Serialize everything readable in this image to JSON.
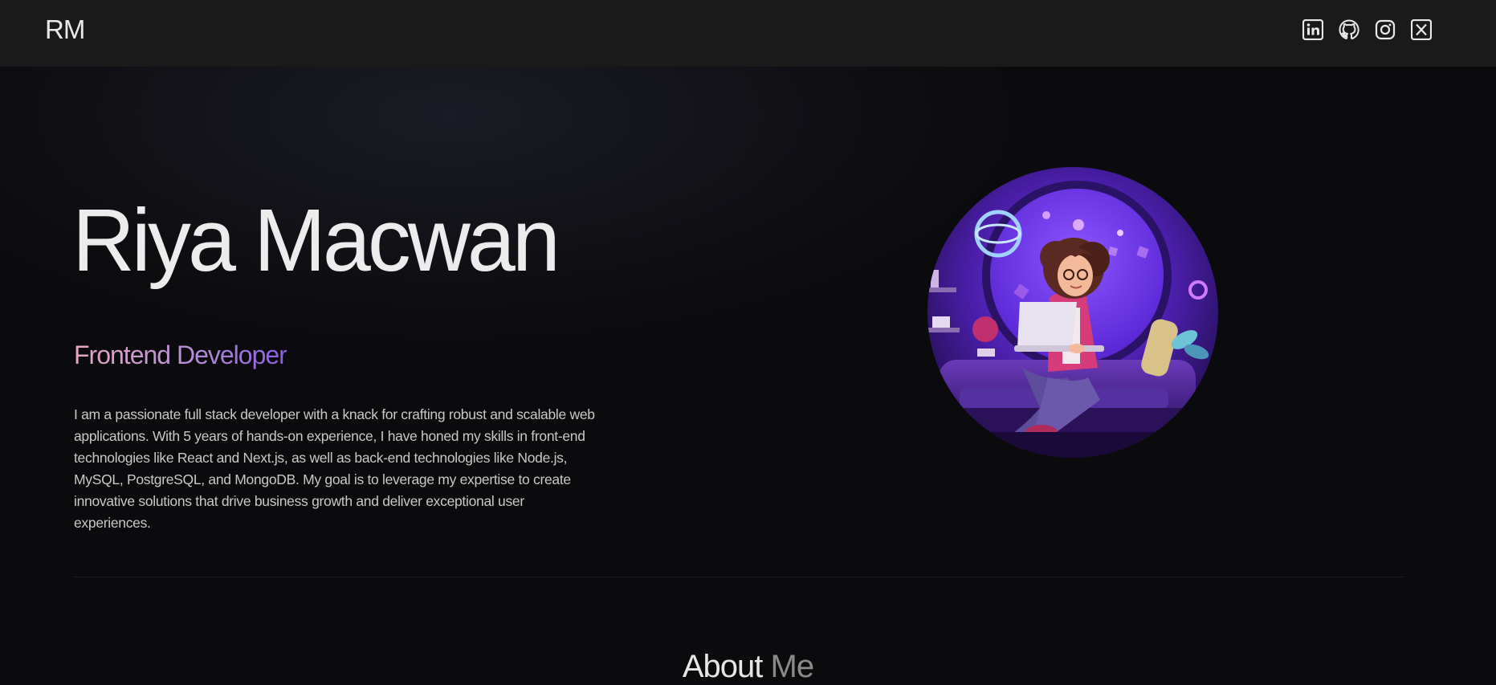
{
  "brand": {
    "logo_text": "RM"
  },
  "socials": [
    {
      "name": "linkedin",
      "icon": "linkedin-icon"
    },
    {
      "name": "github",
      "icon": "github-icon"
    },
    {
      "name": "instagram",
      "icon": "instagram-icon"
    },
    {
      "name": "x",
      "icon": "x-icon"
    }
  ],
  "hero": {
    "name": "Riya Macwan",
    "role": "Frontend Developer",
    "bio": "I am a passionate full stack developer with a knack for crafting robust and scalable web applications. With 5 years of hands-on experience, I have honed my skills in front-end technologies like React and Next.js, as well as back-end technologies like Node.js, MySQL, PostgreSQL, and MongoDB. My goal is to leverage my expertise to create innovative solutions that drive business growth and deliver exceptional user experiences.",
    "avatar": "developer-illustration"
  },
  "about": {
    "title_part1": "About",
    "title_part2": "Me"
  },
  "colors": {
    "background": "#0b0b0d",
    "navbar": "#1a1a1a",
    "role_gradient_start": "#e9a6c3",
    "role_gradient_end": "#8a5ee0",
    "accent_purple": "#6d3fe0"
  }
}
